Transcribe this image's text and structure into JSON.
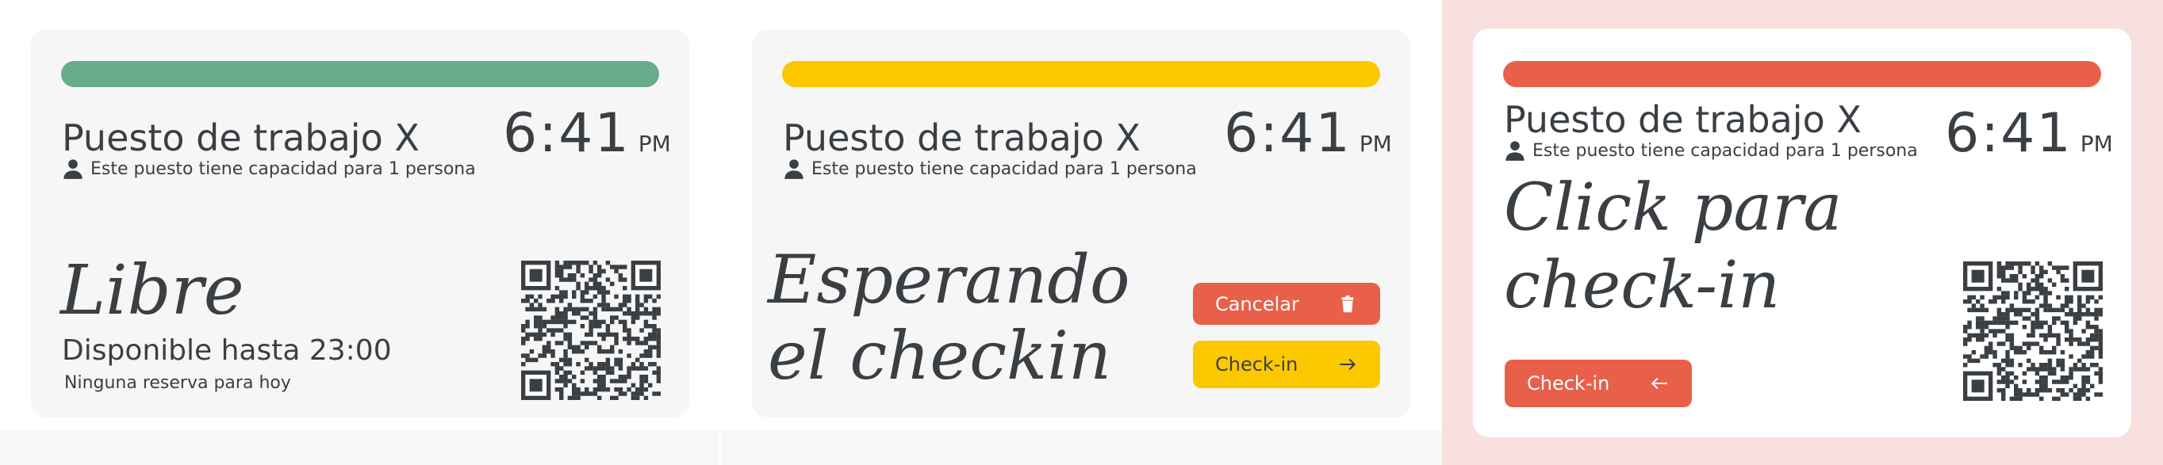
{
  "colors": {
    "green": "#67ad8c",
    "yellow": "#fcc800",
    "red": "#e9604a",
    "text": "#3a3f44",
    "panel3_bg": "#f8e0de"
  },
  "icons": {
    "person": "person-icon",
    "trash": "trash-icon",
    "arrow_right": "arrow-right-icon",
    "arrow_left": "arrow-left-icon",
    "qr": "qr-code"
  },
  "cards": [
    {
      "state": "free",
      "title": "Puesto de trabajo X",
      "capacity": "Este puesto tiene capacidad para 1 persona",
      "time": "6:41",
      "ampm": "PM",
      "status": "Libre",
      "available_until": "Disponible hasta 23:00",
      "reservations": "Ninguna reserva para hoy"
    },
    {
      "state": "waiting",
      "title": "Puesto de trabajo X",
      "capacity": "Este puesto tiene capacidad para 1 persona",
      "time": "6:41",
      "ampm": "PM",
      "status_line1": "Esperando",
      "status_line2": "el checkin",
      "cancel_label": "Cancelar",
      "checkin_label": "Check-in"
    },
    {
      "state": "click",
      "title": "Puesto de trabajo X",
      "capacity": "Este puesto tiene capacidad para 1 persona",
      "time": "6:41",
      "ampm": "PM",
      "status_line1": "Click para",
      "status_line2": "check-in",
      "checkin_label": "Check-in"
    }
  ]
}
